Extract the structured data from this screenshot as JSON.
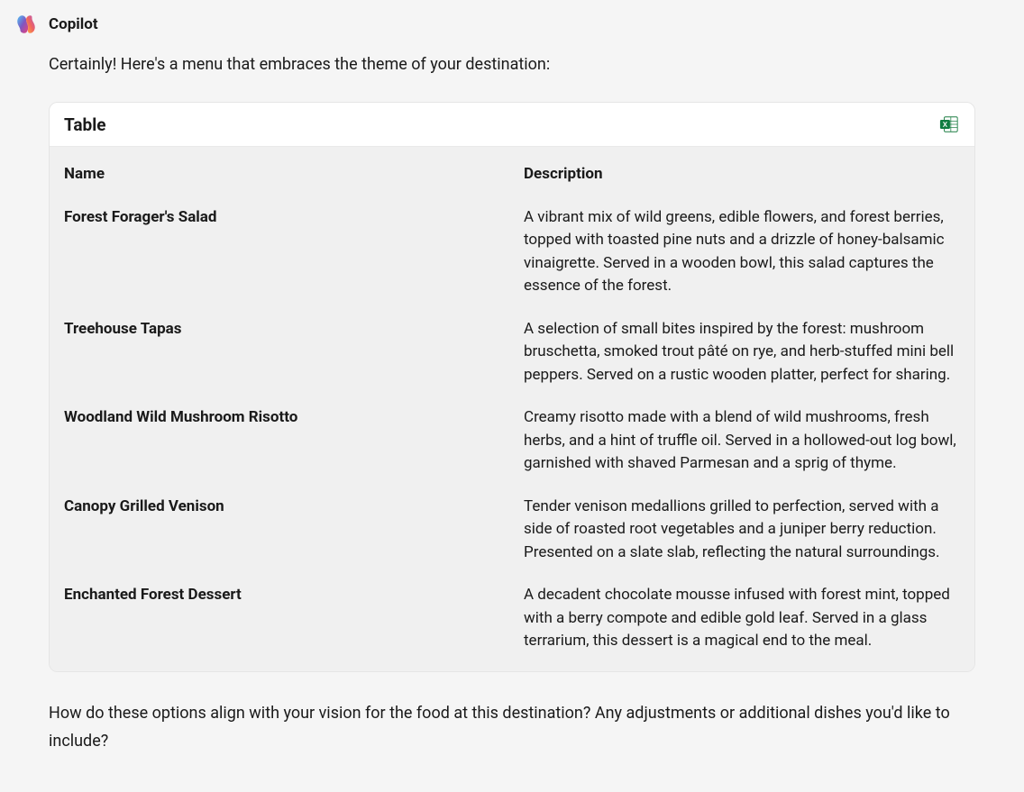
{
  "header": {
    "name": "Copilot"
  },
  "intro": "Certainly! Here's a menu that embraces the theme of your destination:",
  "table": {
    "title": "Table",
    "columns": {
      "name": "Name",
      "description": "Description"
    },
    "rows": [
      {
        "name": "Forest Forager's Salad",
        "description": "A vibrant mix of wild greens, edible flowers, and forest berries, topped with toasted pine nuts and a drizzle of honey-balsamic vinaigrette. Served in a wooden bowl, this salad captures the essence of the forest."
      },
      {
        "name": "Treehouse Tapas",
        "description": "A selection of small bites inspired by the forest: mushroom bruschetta, smoked trout pâté on rye, and herb-stuffed mini bell peppers. Served on a rustic wooden platter, perfect for sharing."
      },
      {
        "name": "Woodland Wild Mushroom Risotto",
        "description": "Creamy risotto made with a blend of wild mushrooms, fresh herbs, and a hint of truffle oil. Served in a hollowed-out log bowl, garnished with shaved Parmesan and a sprig of thyme."
      },
      {
        "name": "Canopy Grilled Venison",
        "description": "Tender venison medallions grilled to perfection, served with a side of roasted root vegetables and a juniper berry reduction. Presented on a slate slab, reflecting the natural surroundings."
      },
      {
        "name": "Enchanted Forest Dessert",
        "description": "A decadent chocolate mousse infused with forest mint, topped with a berry compote and edible gold leaf. Served in a glass terrarium, this dessert is a magical end to the meal."
      }
    ]
  },
  "outro": "How do these options align with your vision for the food at this destination? Any adjustments or additional dishes you'd like to include?"
}
